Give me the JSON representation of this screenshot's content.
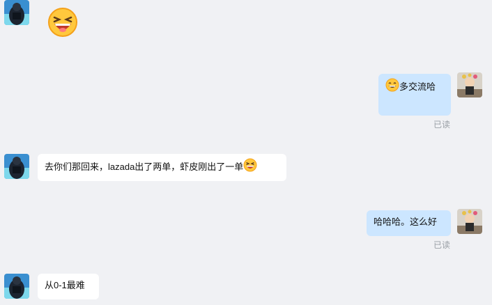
{
  "messages": [
    {
      "id": "m1",
      "from": "other",
      "type": "emoji",
      "emoji": "laughing-face"
    },
    {
      "id": "m2",
      "from": "self",
      "emoji": "grinning-face",
      "text": "多交流哈",
      "status": "已读"
    },
    {
      "id": "m3",
      "from": "other",
      "text": "去你们那回来，lazada出了两单，虾皮刚出了一单",
      "emoji": "laughing-face"
    },
    {
      "id": "m4",
      "from": "self",
      "text": "哈哈哈。这么好",
      "status": "已读"
    },
    {
      "id": "m5",
      "from": "other",
      "text": "从0-1最难"
    }
  ],
  "colors": {
    "background": "#f0f1f4",
    "incoming_bubble": "#ffffff",
    "outgoing_bubble": "#cce6ff",
    "read_text": "#9aa0a6"
  }
}
